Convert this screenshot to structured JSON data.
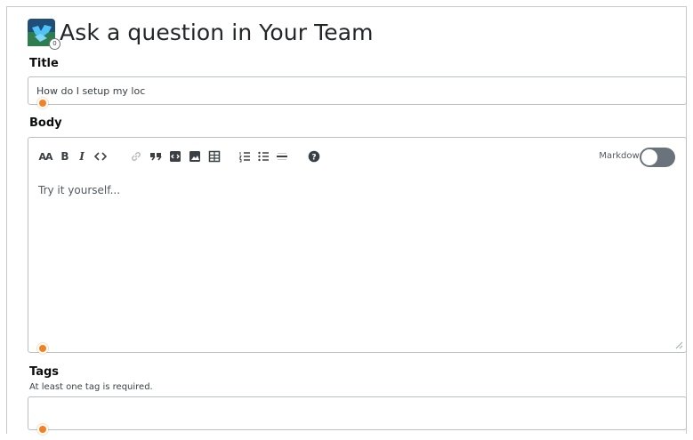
{
  "page": {
    "title": "Ask a question in Your Team"
  },
  "title_field": {
    "label": "Title",
    "value": "How do I setup my loc"
  },
  "body_field": {
    "label": "Body",
    "placeholder": "Try it yourself...",
    "markdown_label": "Markdown",
    "markdown_on": false,
    "toolbar": [
      "text-size",
      "bold",
      "italic",
      "code",
      "link",
      "blockquote",
      "code-block",
      "image",
      "table",
      "ordered-list",
      "unordered-list",
      "horizontal-rule",
      "help"
    ]
  },
  "tags_field": {
    "label": "Tags",
    "hint": "At least one tag is required."
  },
  "colors": {
    "accent": "#f48024",
    "toggle_off": "#6a737c",
    "border": "#babfc4"
  }
}
